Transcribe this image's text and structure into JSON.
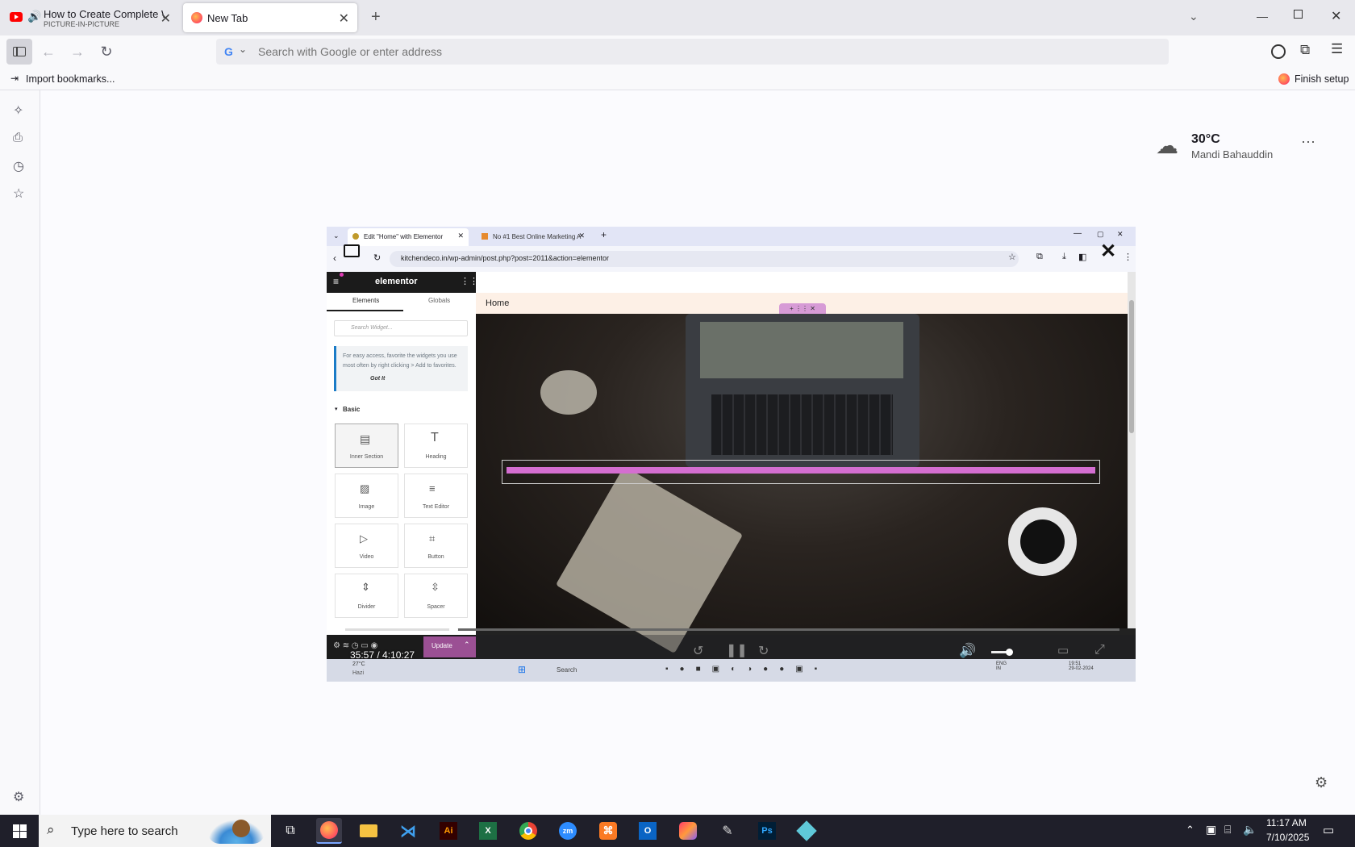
{
  "tabs": [
    {
      "title": "How to Create Complete W",
      "subtitle": "PICTURE-IN-PICTURE"
    },
    {
      "title": "New Tab"
    }
  ],
  "urlbar": {
    "placeholder": "Search with Google or enter address"
  },
  "bookmarks": {
    "import_label": "Import bookmarks...",
    "finish_setup": "Finish setup"
  },
  "weather": {
    "temp": "30°C",
    "location": "Mandi Bahauddin"
  },
  "video": {
    "time": "35:57 / 4:10:27",
    "inner": {
      "tabs": [
        "Edit \"Home\" with Elementor",
        "No #1 Best Online Marketing A"
      ],
      "url": "kitchendeco.in/wp-admin/post.php?post=2011&action=elementor",
      "brand": "elementor",
      "panel_tabs": [
        "Elements",
        "Globals"
      ],
      "search_placeholder": "Search Widget...",
      "tip": "For easy access, favorite the widgets you use most often by right clicking > Add to favorites.",
      "tip_link": "Got It",
      "section": "Basic",
      "widgets": [
        "Inner Section",
        "Heading",
        "Image",
        "Text Editor",
        "Video",
        "Button",
        "Divider",
        "Spacer"
      ],
      "nav_home": "Home",
      "update": "Update",
      "weather": "27°C",
      "weather_sub": "Hazi",
      "search": "Search",
      "lang": "ENG\nIN",
      "clock": "19:51\n29-02-2024"
    }
  },
  "taskbar": {
    "search_placeholder": "Type here to search",
    "time": "11:17 AM",
    "date": "7/10/2025"
  },
  "colors": {
    "tabstrip": "#e8e8ed",
    "elementor_accent": "#9b5094",
    "taskbar": "#1f1f2a"
  }
}
